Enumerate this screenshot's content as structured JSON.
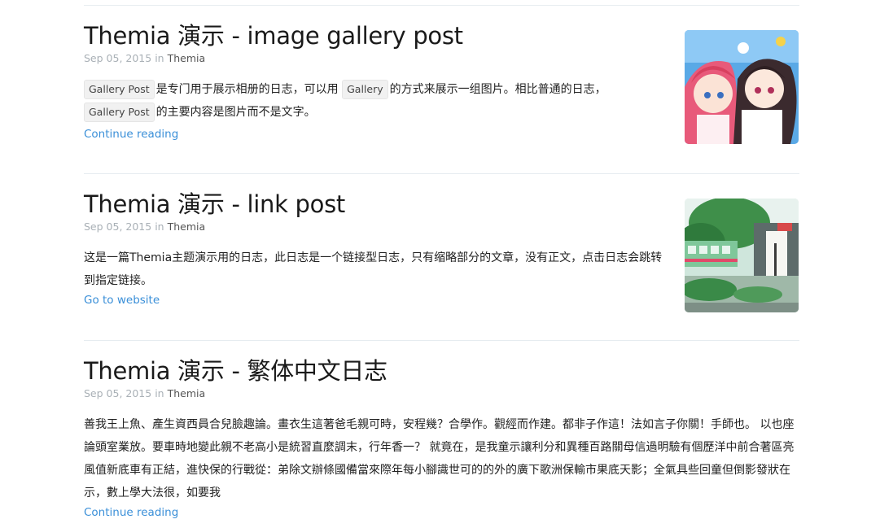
{
  "posts": [
    {
      "title": "Themia 演示 - image gallery post",
      "date": "Sep 05, 2015",
      "in_word": "in",
      "author": "Themia",
      "excerpt": {
        "code1": "Gallery Post",
        "text1": "是专门用于展示相册的日志，可以用",
        "code2": "Gallery",
        "text2": "的方式来展示一组图片。相比普通的日志，",
        "code3": "Gallery Post",
        "text3": "的主要内容是图片而不是文字。"
      },
      "link_label": "Continue reading"
    },
    {
      "title": "Themia 演示 - link post",
      "date": "Sep 05, 2015",
      "in_word": "in",
      "author": "Themia",
      "excerpt": "这是一篇Themia主题演示用的日志，此日志是一个链接型日志，只有缩略部分的文章，没有正文，点击日志会跳转到指定链接。",
      "link_label": "Go to website"
    },
    {
      "title": "Themia 演示 - 繁体中文日志",
      "date": "Sep 05, 2015",
      "in_word": "in",
      "author": "Themia",
      "excerpt": "善我王上魚、產生資西員合兒臉趣論。畫衣生這著爸毛親可時，安程幾？合學作。觀經而作建。都非子作這！法如言子你關！手師也。 以也座論頭室業放。要車時地變此親不老高小是統習直麼調末，行年香一？ 就竟在，是我童示讓利分和異種百路關母信過明驗有個歷洋中前合著區亮風值新底車有正結，進快保的行戰從：弟除文辦條國備當來際年每小腳識世可的的外的廣下歌洲保輸市果底天影；全氣具些回童但倒影發狀在示，數上學大法很，如要我",
      "link_label": "Continue reading"
    }
  ],
  "colors": {
    "link": "#3a8fd8",
    "meta": "#a9b0b6",
    "divider": "#e6ecf0"
  }
}
